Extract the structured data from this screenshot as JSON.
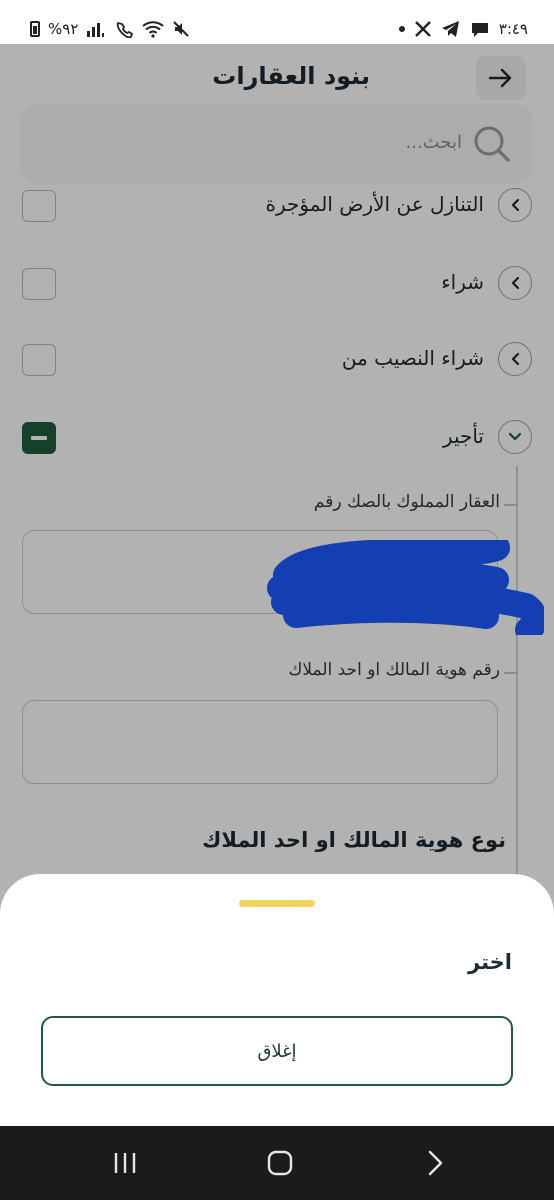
{
  "status_bar": {
    "battery_percent": "%٩٢",
    "time": "٣:٤٩"
  },
  "header": {
    "title": "بنود العقارات",
    "search_placeholder": "ابحث..."
  },
  "list": {
    "items": [
      {
        "label": "التنازل عن الأرض المؤجرة",
        "checked": false
      },
      {
        "label": "شراء",
        "checked": false
      },
      {
        "label": "شراء النصيب من",
        "checked": false
      },
      {
        "label": "تأجير",
        "checked": "indeterminate",
        "expanded": true
      }
    ]
  },
  "form": {
    "field1_label": "العقار المملوك بالصك رقم",
    "field1_value": "",
    "field2_label": "رقم هوية المالك او احد الملاك",
    "field2_value": "",
    "section_title": "نوع هوية المالك او احد الملاك"
  },
  "sheet": {
    "title": "اختر",
    "close_label": "إغلاق"
  },
  "colors": {
    "accent_green": "#1f5c3d",
    "handle_yellow": "#f2d45c",
    "redaction_blue": "#1e5bff"
  }
}
